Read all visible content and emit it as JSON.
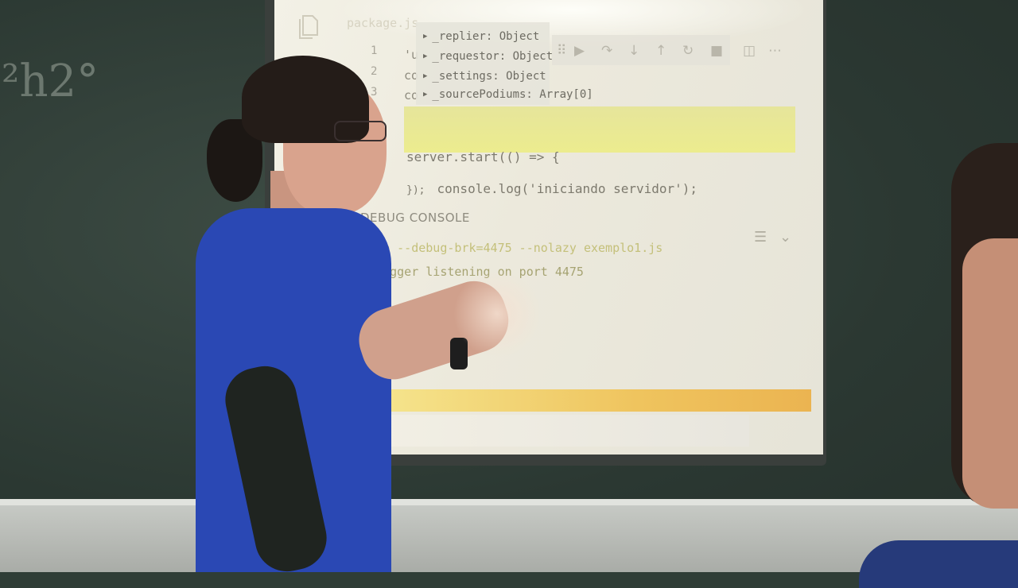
{
  "scene": {
    "chalk_marks": [
      "²h2°"
    ]
  },
  "editor": {
    "tab_label": "package.js",
    "line_numbers": [
      "1",
      "2",
      "3"
    ],
    "code_fragments": [
      "'u",
      "co",
      "co"
    ],
    "object_popup": {
      "rows": [
        "_replier: Object",
        "_requestor: Object",
        "_settings: Object",
        "_sourcePodiums: Array[0]"
      ]
    },
    "toolbar_icons": [
      "drag-handle-icon",
      "play-icon",
      "step-over-icon",
      "step-into-icon",
      "step-out-icon",
      "restart-icon",
      "stop-icon"
    ],
    "code_lines": [
      "server.start(() => {",
      "    console.log('iniciando servidor');",
      "});"
    ]
  },
  "debug_console": {
    "title": "DEBUG CONSOLE",
    "lines": [
      "node --debug-brk=4475 --nolazy exemplo1.js",
      "Debugger listening on port 4475"
    ]
  },
  "colors": {
    "status_bar": "#efc45e",
    "highlight": "#e6e59b",
    "shirt": "#2a48b4"
  }
}
